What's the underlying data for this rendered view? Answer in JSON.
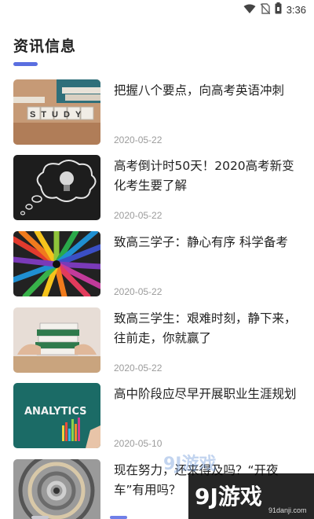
{
  "status_bar": {
    "time": "3:36",
    "icons": [
      "wifi-icon",
      "no-sim-icon",
      "battery-icon"
    ]
  },
  "page": {
    "title": "资讯信息",
    "accent_color": "#5a6ee0"
  },
  "news": [
    {
      "title": "把握八个要点，向高考英语冲刺",
      "date": "2020-05-22",
      "thumb": "study-blocks-image",
      "thumb_text": "STUDY"
    },
    {
      "title": "高考倒计时50天！2020高考新变化考生要了解",
      "date": "2020-05-22",
      "thumb": "lightbulb-cloud-image"
    },
    {
      "title": "致高三学子：静心有序 科学备考",
      "date": "2020-05-22",
      "thumb": "colored-pencils-image"
    },
    {
      "title": "致高三学生：艰难时刻，静下来，往前走，你就赢了",
      "date": "2020-05-22",
      "thumb": "stacked-books-image"
    },
    {
      "title": "高中阶段应尽早开展职业生涯规划",
      "date": "2020-05-10",
      "thumb": "analytics-chalkboard-image",
      "thumb_text": "ANALYTICS"
    },
    {
      "title": "现在努力，还来得及吗？“开夜车”有用吗？",
      "date": "",
      "thumb": "paper-spiral-image"
    }
  ],
  "watermark": {
    "logo": "9J游戏",
    "url": "91danji.com",
    "ghost": "9J游戏"
  }
}
